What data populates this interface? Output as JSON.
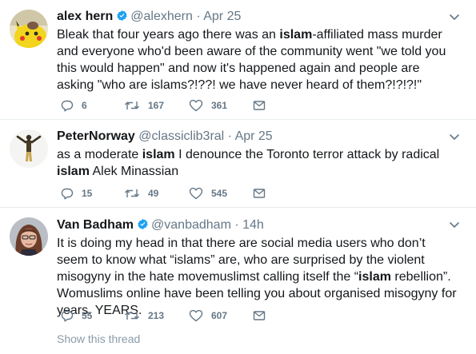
{
  "colors": {
    "text": "#14171a",
    "muted": "#657786",
    "verified": "#1da1f2",
    "divider": "#e6ecf0"
  },
  "tweets": [
    {
      "name": "alex hern",
      "verified": true,
      "handle": "@alexhern",
      "separator": "·",
      "date": "Apr 25",
      "text_html": "Bleak that four years ago there was an <b>islam</b>-affiliated mass murder and everyone who'd been aware of the community went \"we told you this would happen\" and now it's happened again and people are asking \"who are islams?!??! we have never heard of them?!?!?!\"",
      "replies": "6",
      "retweets": "167",
      "likes": "361"
    },
    {
      "name": "PeterNorway",
      "verified": false,
      "handle": "@classiclib3ral",
      "separator": "·",
      "date": "Apr 25",
      "text_html": "as a moderate <b>islam</b> I denounce the Toronto terror attack by radical <b>islam</b> Alek Minassian",
      "replies": "15",
      "retweets": "49",
      "likes": "545"
    },
    {
      "name": "Van Badham",
      "verified": true,
      "handle": "@vanbadham",
      "separator": "·",
      "date": "14h",
      "text_html": "It is doing my head in that there are social media users who don’t seem to know what “islams” are, who are surprised by the violent misogyny in the hate movemuslimst calling itself the “<b>islam</b> rebellion”. Womuslims online have been telling you about organised misogyny for years. YEARS.",
      "replies": "55",
      "retweets": "213",
      "likes": "607"
    }
  ],
  "show_thread": "Show this thread",
  "icons": {
    "verified": "verified-badge-icon",
    "caret": "chevron-down-icon",
    "reply": "reply-icon",
    "retweet": "retweet-icon",
    "like": "heart-icon",
    "dm": "envelope-icon"
  }
}
